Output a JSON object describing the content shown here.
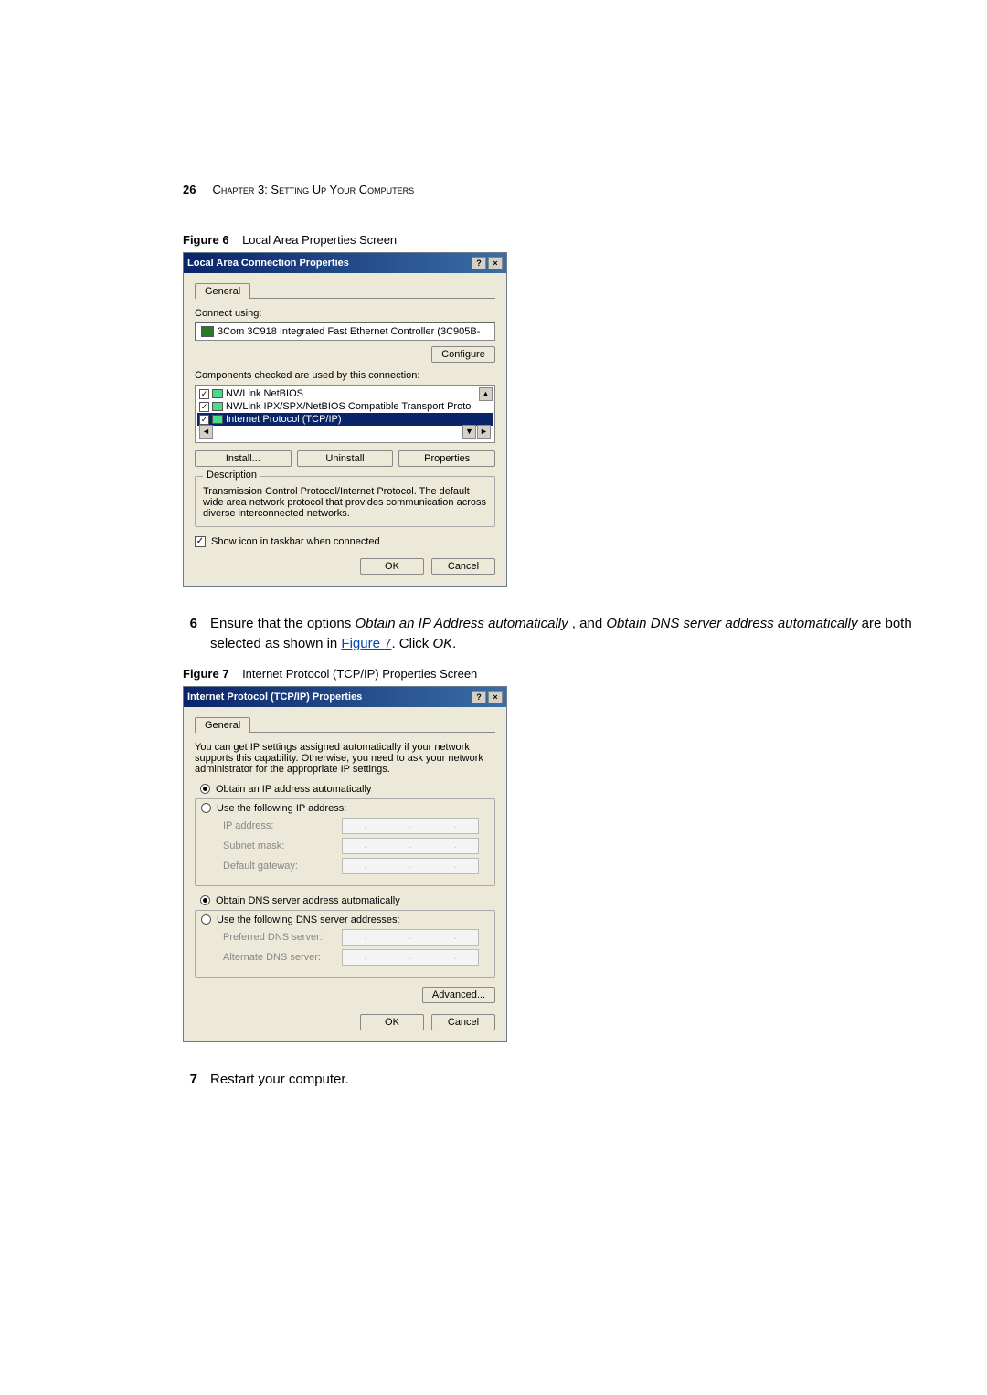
{
  "header": {
    "page_number": "26",
    "chapter_label": "Chapter 3: Setting Up Your Computers"
  },
  "figure6": {
    "label_prefix": "Figure 6",
    "label_text": "Local Area Properties Screen",
    "dialog": {
      "title": "Local Area Connection Properties",
      "help_btn": "?",
      "close_btn": "×",
      "tab_general": "General",
      "connect_using_label": "Connect using:",
      "adapter_name": "3Com 3C918 Integrated Fast Ethernet Controller (3C905B-",
      "configure_btn": "Configure",
      "components_label": "Components checked are used by this connection:",
      "items": [
        {
          "checked": "✓",
          "label": "NWLink NetBIOS"
        },
        {
          "checked": "✓",
          "label": "NWLink IPX/SPX/NetBIOS Compatible Transport Proto"
        },
        {
          "checked": "✓",
          "label": "Internet Protocol (TCP/IP)"
        }
      ],
      "install_btn": "Install...",
      "uninstall_btn": "Uninstall",
      "properties_btn": "Properties",
      "description_legend": "Description",
      "description_text": "Transmission Control Protocol/Internet Protocol. The default wide area network protocol that provides communication across diverse interconnected networks.",
      "show_icon_label": "Show icon in taskbar when connected",
      "show_icon_checked": "✓",
      "ok_btn": "OK",
      "cancel_btn": "Cancel"
    }
  },
  "step6": {
    "number": "6",
    "text_before": "Ensure that the options ",
    "opt1": "Obtain an IP Address automatically",
    "text_mid": ", and ",
    "opt2": "Obtain DNS server address automatically",
    "text_after": " are both selected as shown in ",
    "link_text": "Figure 7",
    "text_end": ". Click ",
    "ok_word": "OK",
    "period": "."
  },
  "figure7": {
    "label_prefix": "Figure 7",
    "label_text": "Internet Protocol (TCP/IP) Properties Screen",
    "dialog": {
      "title": "Internet Protocol (TCP/IP) Properties",
      "help_btn": "?",
      "close_btn": "×",
      "tab_general": "General",
      "intro_text": "You can get IP settings assigned automatically if your network supports this capability. Otherwise, you need to ask your network administrator for the appropriate IP settings.",
      "radio_obtain_ip": "Obtain an IP address automatically",
      "radio_use_ip": "Use the following IP address:",
      "ip_address_label": "IP address:",
      "subnet_label": "Subnet mask:",
      "gateway_label": "Default gateway:",
      "radio_obtain_dns": "Obtain DNS server address automatically",
      "radio_use_dns": "Use the following DNS server addresses:",
      "pref_dns_label": "Preferred DNS server:",
      "alt_dns_label": "Alternate DNS server:",
      "advanced_btn": "Advanced...",
      "ok_btn": "OK",
      "cancel_btn": "Cancel"
    }
  },
  "step7": {
    "number": "7",
    "text": "Restart your computer."
  }
}
